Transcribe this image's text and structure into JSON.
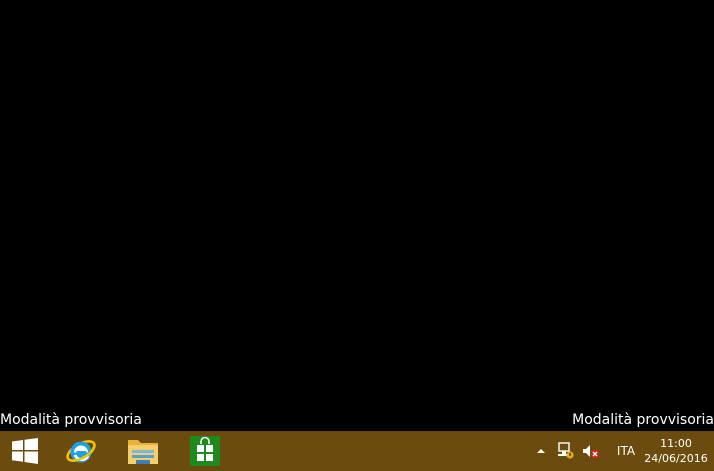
{
  "desktop": {
    "safe_mode_left": "Modalità provvisoria",
    "safe_mode_right": "Modalità provvisoria"
  },
  "taskbar": {
    "background": "#6b4c0e",
    "start_icon": "windows-logo-icon",
    "pinned": [
      {
        "name": "internet-explorer-icon"
      },
      {
        "name": "file-explorer-icon"
      },
      {
        "name": "store-icon"
      }
    ]
  },
  "tray": {
    "show_hidden_icon": "chevron-up-icon",
    "network_icon": "network-icon",
    "volume_icon": "volume-muted-icon",
    "language": "ITA",
    "time": "11:00",
    "date": "24/06/2016"
  }
}
